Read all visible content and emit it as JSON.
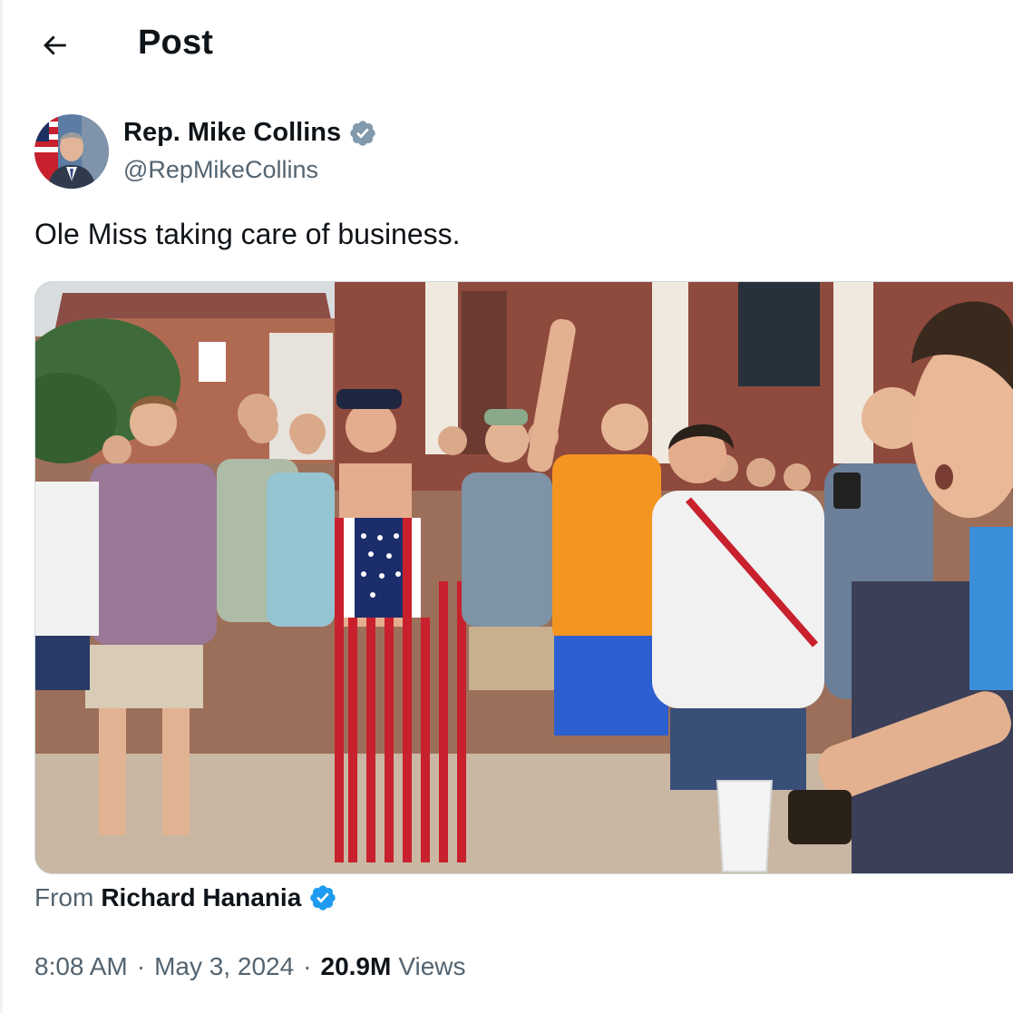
{
  "header": {
    "title": "Post",
    "back_icon": "arrow-left-icon"
  },
  "post": {
    "author": {
      "name": "Rep. Mike Collins",
      "handle": "@RepMikeCollins",
      "verified_badge": "verified-gray-badge-icon",
      "badge_color": "#829aab"
    },
    "text": "Ole Miss taking care of business.",
    "media": {
      "kind": "video-still",
      "description_icon": "crowd-photo"
    },
    "source": {
      "label": "From",
      "name": "Richard Hanania",
      "verified_badge": "verified-blue-badge-icon",
      "badge_color": "#1d9bf0"
    },
    "meta": {
      "time": "8:08 AM",
      "date": "May 3, 2024",
      "views_count": "20.9M",
      "views_label": "Views",
      "separator": "·"
    }
  },
  "colors": {
    "text_primary": "#0f1419",
    "text_secondary": "#536471",
    "border": "#cfd9de"
  }
}
